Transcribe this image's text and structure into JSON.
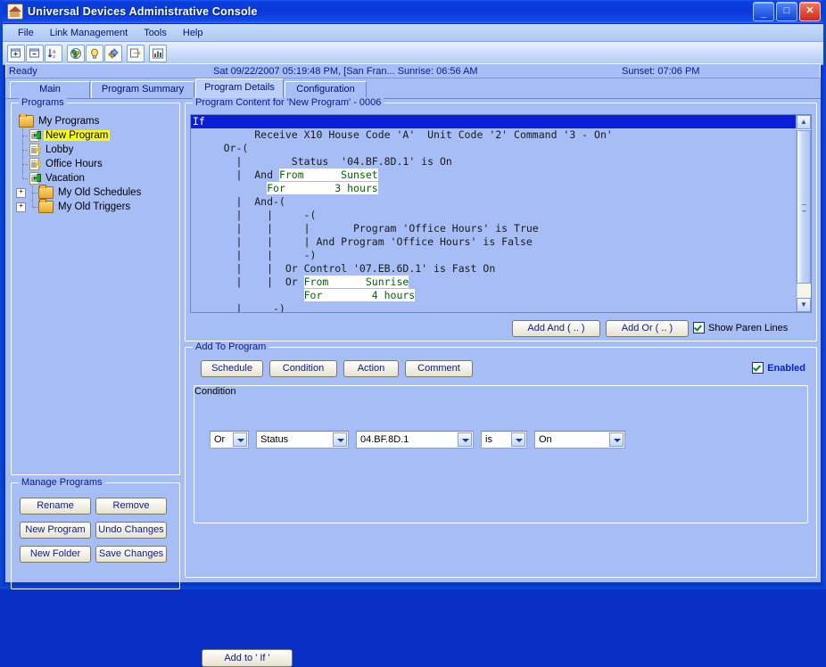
{
  "window": {
    "title": "Universal Devices Administrative Console",
    "icon": "house-icon",
    "minimize": "_",
    "maximize": "□",
    "close": "✕"
  },
  "menu": [
    "File",
    "Link Management",
    "Tools",
    "Help"
  ],
  "toolbar": [
    {
      "name": "add-node-icon"
    },
    {
      "name": "remove-node-icon"
    },
    {
      "name": "sort-az-icon"
    },
    {
      "name": "scene-icon"
    },
    {
      "name": "light-bulb-icon"
    },
    {
      "name": "link-icon"
    },
    {
      "name": "export-icon"
    },
    {
      "name": "chart-icon"
    }
  ],
  "status": {
    "ready": "Ready",
    "datetime": "Sat 09/22/2007 05:19:48 PM,  [San Fran... Sunrise: 06:56 AM",
    "sunset": "Sunset: 07:06 PM"
  },
  "tabs": [
    {
      "label": "Main",
      "selected": false
    },
    {
      "label": "Program Summary",
      "selected": false
    },
    {
      "label": "Program Details",
      "selected": true
    },
    {
      "label": "Configuration",
      "selected": false
    }
  ],
  "programs_panel": {
    "legend": "Programs",
    "tree": [
      {
        "label": "My Programs",
        "kind": "folder",
        "depth": 0,
        "expander": null,
        "selected": false
      },
      {
        "label": "New Program",
        "kind": "program-green",
        "depth": 1,
        "expander": null,
        "selected": true
      },
      {
        "label": "Lobby",
        "kind": "program-yellow",
        "depth": 1,
        "expander": null,
        "selected": false
      },
      {
        "label": "Office Hours",
        "kind": "program-yellow",
        "depth": 1,
        "expander": null,
        "selected": false
      },
      {
        "label": "Vacation",
        "kind": "program-green",
        "depth": 1,
        "expander": null,
        "selected": false
      },
      {
        "label": "My Old Schedules",
        "kind": "folder",
        "depth": 0,
        "expander": "+",
        "selected": false
      },
      {
        "label": "My Old Triggers",
        "kind": "folder",
        "depth": 0,
        "expander": "+",
        "selected": false
      }
    ]
  },
  "manage_panel": {
    "legend": "Manage Programs",
    "buttons": [
      "Rename",
      "Remove",
      "New Program",
      "Undo Changes",
      "New Folder",
      "Save Changes"
    ]
  },
  "program_content": {
    "legend": "Program Content for 'New Program' - 0006",
    "lines": [
      {
        "text": "If",
        "style": "if"
      },
      {
        "text": "          Receive X10 House Code 'A'  Unit Code '2' Command '3 - On'",
        "style": "plain"
      },
      {
        "text": "     Or-(",
        "style": "plain"
      },
      {
        "text": "       |        Status  '04.BF.8D.1' is On",
        "style": "plain"
      },
      {
        "text": "       |  And ",
        "style": "plain",
        "hl": "From      Sunset"
      },
      {
        "text": "            ",
        "style": "plain",
        "hl": "For        3 hours"
      },
      {
        "text": "       |  And-(",
        "style": "plain"
      },
      {
        "text": "       |    |     -(",
        "style": "plain"
      },
      {
        "text": "       |    |     |       Program 'Office Hours' is True",
        "style": "plain"
      },
      {
        "text": "       |    |     | And Program 'Office Hours' is False",
        "style": "plain"
      },
      {
        "text": "       |    |     -)",
        "style": "plain"
      },
      {
        "text": "       |    |  Or Control '07.EB.6D.1' is Fast On",
        "style": "plain"
      },
      {
        "text": "       |    |  Or ",
        "style": "plain",
        "hl": "From      Sunrise"
      },
      {
        "text": "                  ",
        "style": "plain",
        "hl": "For        4 hours"
      },
      {
        "text": "       |     -)",
        "style": "plain"
      },
      {
        "text": "     -)",
        "style": "plain"
      }
    ],
    "add_and_label": "Add And ( .. )",
    "add_or_label": "Add Or ( .. )",
    "show_paren_label": "Show Paren Lines",
    "show_paren_checked": true,
    "scroll_up": "▲",
    "scroll_down": "▼"
  },
  "add_to_program": {
    "legend": "Add To Program",
    "buttons": [
      "Schedule",
      "Condition",
      "Action",
      "Comment"
    ],
    "enabled_label": "Enabled",
    "enabled_checked": true,
    "condition_legend": "Condition",
    "dropdowns": [
      {
        "name": "logic-operator",
        "value": "Or"
      },
      {
        "name": "condition-type",
        "value": "Status"
      },
      {
        "name": "device-address",
        "value": "04.BF.8D.1"
      },
      {
        "name": "comparison",
        "value": "is"
      },
      {
        "name": "state",
        "value": "On"
      }
    ],
    "add_button": "Add to ' If '"
  }
}
